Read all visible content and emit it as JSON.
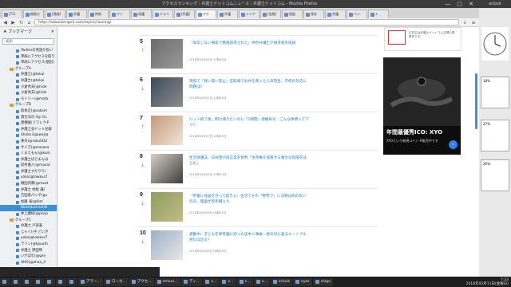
{
  "window": {
    "title": "アクセスランキング｜弁護士ドットコムニュース｜弁護士ドットコム - Mozilla Firefox",
    "controls": "— ▢ ✕"
  },
  "tabs": [
    {
      "label": "[71]"
    },
    {
      "label": "総務大"
    },
    {
      "label": "[保険]"
    },
    {
      "label": "弁護"
    },
    {
      "label": "時刻"
    },
    {
      "label": "ファ"
    },
    {
      "label": "保護"
    },
    {
      "label": "ドライ"
    },
    {
      "label": "[弁護]"
    },
    {
      "label": "アク"
    },
    {
      "label": "弁護"
    },
    {
      "label": "リンク"
    },
    {
      "label": "[金融]"
    },
    {
      "label": "相談"
    },
    {
      "label": "保存"
    },
    {
      "label": "弁護"
    },
    {
      "label": "ベン"
    },
    {
      "label": "+"
    }
  ],
  "url": "https://www.bengo4.com/topics/ranking/",
  "sidebar": {
    "title": "ブックマーク",
    "close": "✕",
    "search_placeholder": "検索",
    "items": [
      {
        "label": "Twitterの英語が長い",
        "kind": "page",
        "indent": 2
      },
      {
        "label": "単純にアクセスを取り",
        "kind": "page",
        "indent": 2
      },
      {
        "label": "単純にアクセス(個別)",
        "kind": "page",
        "indent": 2
      },
      {
        "label": "グループA",
        "kind": "folder",
        "indent": 1
      },
      {
        "label": "弁護士(@tokai",
        "kind": "page",
        "indent": 2
      },
      {
        "label": "弁護士(@tokai",
        "kind": "page",
        "indent": 2
      },
      {
        "label": "小倉秀夫(@hide",
        "kind": "page",
        "indent": 2
      },
      {
        "label": "小倉秀夫(@hide",
        "kind": "page",
        "indent": 2
      },
      {
        "label": "モトリー(@moto",
        "kind": "page",
        "indent": 2
      },
      {
        "label": "グループB",
        "kind": "folder",
        "indent": 1
      },
      {
        "label": "坂本正(@sakam",
        "kind": "page",
        "indent": 2
      },
      {
        "label": "落合洋司 Yoji Oc",
        "kind": "page",
        "indent": 2
      },
      {
        "label": "唐橋綾(ゾフレクチ",
        "kind": "page",
        "indent": 2
      },
      {
        "label": "弁護士会ドット記録",
        "kind": "page",
        "indent": 2
      },
      {
        "label": "Shoko Egawa(@",
        "kind": "page",
        "indent": 2
      },
      {
        "label": "楽天(@rakuSOU",
        "kind": "page",
        "indent": 2
      },
      {
        "label": "サイズ(@masasa",
        "kind": "page",
        "indent": 2
      },
      {
        "label": "くまえもん(@kum",
        "kind": "page",
        "indent": 2
      },
      {
        "label": "弁護士ぱさまんほ",
        "kind": "page",
        "indent": 2
      },
      {
        "label": "前村雅人(@masat",
        "kind": "page",
        "indent": 2
      },
      {
        "label": "弁護士すだりり(",
        "kind": "page",
        "indent": 2
      },
      {
        "label": "yoko(@lawkusT",
        "kind": "page",
        "indent": 2
      },
      {
        "label": "桐田弥壽(@moot",
        "kind": "page",
        "indent": 2
      },
      {
        "label": "弁護士 村松 謙(",
        "kind": "page",
        "indent": 2
      },
      {
        "label": "吉田家パンチ(gu",
        "kind": "page",
        "indent": 2
      },
      {
        "label": "加藤 竜(@Kat",
        "kind": "page",
        "indent": 2
      },
      {
        "label": "Washdashed(W",
        "kind": "page",
        "indent": 2,
        "selected": true
      },
      {
        "label": "井上康紀(@penp",
        "kind": "page",
        "indent": 2
      },
      {
        "label": "グループC",
        "kind": "folder",
        "indent": 1
      },
      {
        "label": "弁護士 戸部泰",
        "kind": "page",
        "indent": 2
      },
      {
        "label": "じゃぐ(/子 どいき",
        "kind": "page",
        "indent": 2
      },
      {
        "label": "yoko(@lawkusT",
        "kind": "page",
        "indent": 2
      },
      {
        "label": "ラリン(@kpuuth",
        "kind": "page",
        "indent": 2
      },
      {
        "label": "弁護士 野田隼",
        "kind": "page",
        "indent": 2
      },
      {
        "label": "いがぱむ(@gen",
        "kind": "page",
        "indent": 2
      },
      {
        "label": "AHO(@ahaa_A",
        "kind": "page",
        "indent": 2
      }
    ]
  },
  "rankings": [
    {
      "rank": "5",
      "trend": "up",
      "title": "「非伝しない事実で懲戒請求された」神奈弁護士が請求者を提訴",
      "date": "2018年05月09日 17時45分"
    },
    {
      "rank": "6",
      "trend": "down",
      "title": "現役で「買い責い禁止」在取場でお弁を買ったら高雪生…学校の対応に問題は?",
      "date": "2018年05月07日 10時45分"
    },
    {
      "rank": "7",
      "trend": "up",
      "title": "バイト終了後、明け帰りたいのに「1時間」待機命令…こんな休憩ってアリ?",
      "date": "2018年05月07日 10時03分"
    },
    {
      "rank": "8",
      "trend": "down",
      "title": "生活保護法、日弁連が反正案を批判「生存権を侵害する重大な危険をはらむ」",
      "date": "2018年05月09日 15時13分"
    },
    {
      "rank": "9",
      "trend": "down",
      "title": "「県警に住居を守って起きる」生活でその「野原ラ」に法務は約の思いの声、理論が足手職入り",
      "date": "2018年05月09日 08時15分"
    },
    {
      "rank": "10",
      "trend": "down",
      "title": "通勤中、子どもを保育園に迎った途中に事故…意の対と通るルートでも労災は出る?",
      "date": "2018年05月03日 06時34分"
    }
  ],
  "ads": {
    "top_text": "広告主は弁護士ドットコム正規の提携先です。",
    "headline": "年間最優秀ICO: XYO",
    "sub": "XYOという新規コイン #販売中です",
    "go": "›"
  },
  "right_app": {
    "title": "xclock",
    "panel_texts": [
      "18%",
      "27%",
      "26%"
    ]
  },
  "status": {
    "line1": "",
    "line2": ""
  },
  "taskbar": {
    "items": [
      "",
      "",
      "",
      "",
      "",
      "",
      "",
      "アラー…",
      "ローカ…",
      "アクセ…",
      "emacs…",
      "ディ…",
      "x…",
      "x…",
      "x…",
      "x…",
      "xclock",
      "eyes",
      "xlogo"
    ],
    "time": "7:33",
    "date": "2018年05月11日(金曜日)"
  },
  "colors": {
    "link": "#1a7fd1",
    "up": "#e08a2b",
    "down": "#3e8fd9",
    "selection": "#3d8fd8"
  }
}
